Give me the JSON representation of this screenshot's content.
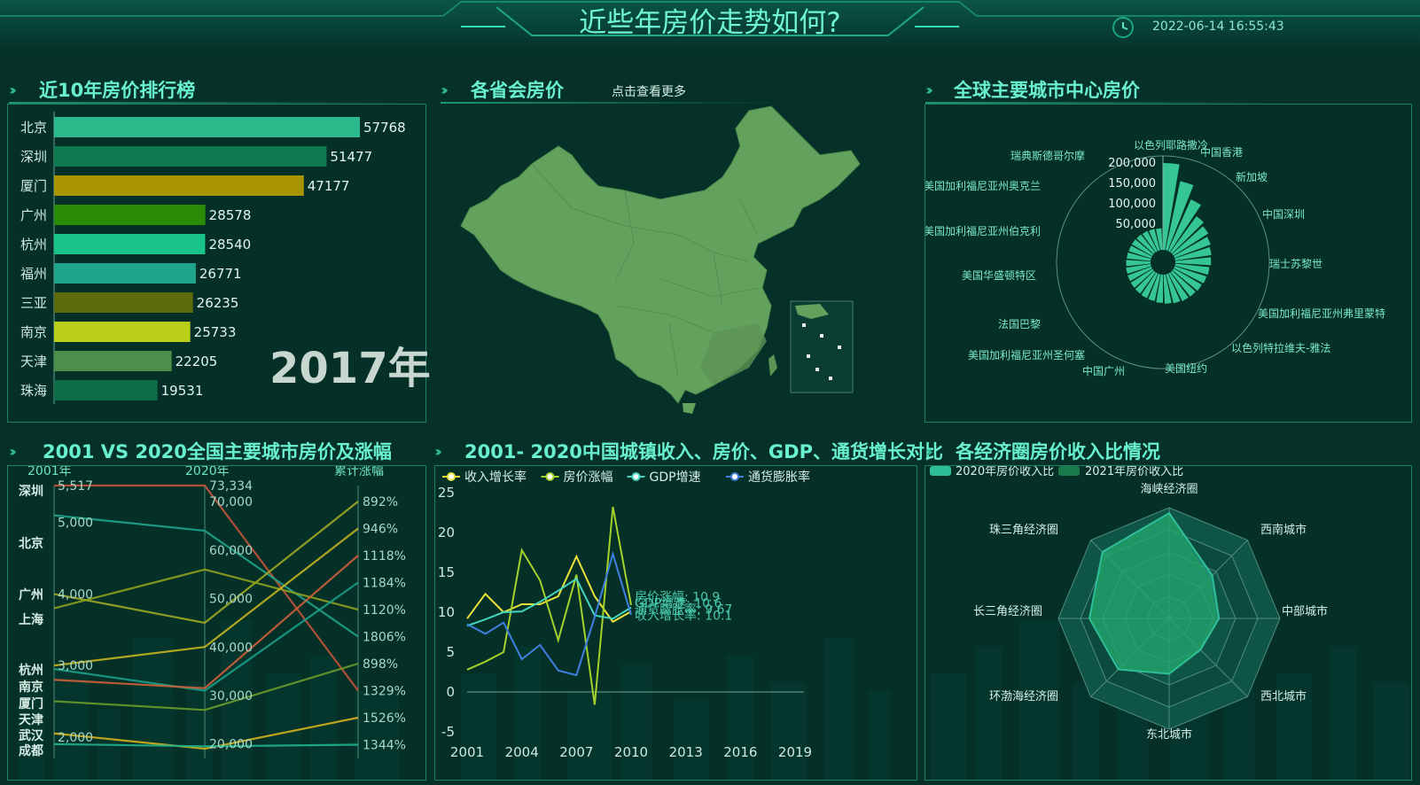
{
  "header": {
    "title": "近些年房价走势如何?",
    "datetime": "2022-06-14 16:55:43"
  },
  "ranking": {
    "title": "近10年房价排行榜",
    "year_label": "2017年",
    "cities": [
      "北京",
      "深圳",
      "厦门",
      "广州",
      "杭州",
      "福州",
      "三亚",
      "南京",
      "天津",
      "珠海"
    ],
    "values": [
      57768,
      51477,
      47177,
      28578,
      28540,
      26771,
      26235,
      25733,
      22205,
      19531
    ],
    "value_labels": [
      "57768",
      "51477",
      "47177",
      "28578",
      "28540",
      "26771",
      "26235",
      "25733",
      "22205",
      "19531"
    ],
    "colors": [
      "#2bb98c",
      "#0f7a52",
      "#a89500",
      "#2a8b06",
      "#18c488",
      "#20a58d",
      "#5d6b0c",
      "#b9cf1a",
      "#4c8f4a",
      "#0c6d47"
    ]
  },
  "map": {
    "title": "各省会房价",
    "more_label": "点击查看更多"
  },
  "global": {
    "title": "全球主要城市中心房价",
    "city_labels": [
      "中国香港",
      "新加坡",
      "中国深圳",
      "瑞士苏黎世",
      "美国加利福尼亚州弗里蒙特",
      "以色列特拉维夫-雅法",
      "美国纽约",
      "中国广州",
      "美国加利福尼亚州圣何塞",
      "法国巴黎",
      "美国华盛顿特区",
      "美国加利福尼亚州伯克利",
      "美国加利福尼亚州奥克兰",
      "瑞典斯德哥尔摩",
      "以色列耶路撒冷"
    ],
    "axis_labels": [
      "200,000",
      "150,000",
      "100,000",
      "50,000"
    ],
    "chart_data": {
      "type": "bar",
      "polar": true,
      "ylim": [
        0,
        200000
      ],
      "values": [
        185000,
        150000,
        120000,
        95000,
        88000,
        82000,
        78000,
        76000,
        73000,
        71000,
        69000,
        67000,
        66000,
        64000,
        62000,
        60000,
        58000,
        57000,
        56000,
        55000,
        54000,
        53000,
        52000,
        51000,
        50000,
        50000,
        49000,
        48000,
        47000,
        46000
      ]
    }
  },
  "parallel": {
    "title": "2001 VS 2020全国主要城市房价及涨幅",
    "axis_names": [
      "2001年",
      "2020年",
      "累计涨幅"
    ],
    "cities": [
      "深圳",
      "北京",
      "广州",
      "上海",
      "杭州",
      "南京",
      "厦门",
      "天津",
      "武汉",
      "成都"
    ],
    "ticks_2001": [
      "5,517",
      "5,000",
      "4,000",
      "3,000",
      "2,000"
    ],
    "ticks_2020": [
      "73,334",
      "70,000",
      "60,000",
      "50,000",
      "40,000",
      "30,000",
      "20,000"
    ],
    "ticks_growth": [
      "892%",
      "946%",
      "1118%",
      "1184%",
      "1120%",
      "1806%",
      "898%",
      "1329%",
      "1526%",
      "1344%"
    ],
    "chart_data": {
      "type": "line",
      "axes": [
        "2001年",
        "2020年",
        "累计涨幅"
      ],
      "series": [
        {
          "name": "深圳",
          "values": [
            5517,
            73334,
            1329
          ]
        },
        {
          "name": "北京",
          "values": [
            5100,
            64000,
            1806
          ]
        },
        {
          "name": "广州",
          "values": [
            4000,
            45000,
            892
          ]
        },
        {
          "name": "上海",
          "values": [
            3800,
            56000,
            1120
          ]
        },
        {
          "name": "杭州",
          "values": [
            3000,
            40000,
            946
          ]
        },
        {
          "name": "南京",
          "values": [
            2950,
            31000,
            1184
          ]
        },
        {
          "name": "厦门",
          "values": [
            2800,
            31500,
            1118
          ]
        },
        {
          "name": "天津",
          "values": [
            2500,
            27000,
            898
          ]
        },
        {
          "name": "武汉",
          "values": [
            2050,
            19000,
            1526
          ]
        },
        {
          "name": "成都",
          "values": [
            1900,
            19500,
            1344
          ]
        }
      ]
    }
  },
  "trend": {
    "title": "2001- 2020中国城镇收入、房价、GDP、通货增长对比",
    "end_labels": [
      "房价涨幅: 10.9",
      "GDP增速: 10.6",
      "通货膨胀率: 9.67",
      "收入增长率: 10.1"
    ],
    "chart_data": {
      "type": "line",
      "x": [
        2001,
        2002,
        2003,
        2004,
        2005,
        2006,
        2007,
        2008,
        2009,
        2010
      ],
      "xticks": [
        "2001",
        "2004",
        "2007",
        "2010",
        "2013",
        "2016",
        "2019"
      ],
      "yticks": [
        "25",
        "20",
        "15",
        "10",
        "5",
        "0",
        "-5"
      ],
      "ylim": [
        -5,
        25
      ],
      "series": [
        {
          "name": "收入增长率",
          "color": "#e8e23a",
          "values": [
            9.2,
            12.3,
            10,
            11,
            11,
            12,
            17,
            12,
            8.8,
            10.1
          ]
        },
        {
          "name": "房价涨幅",
          "color": "#a4d22c",
          "values": [
            2.8,
            3.8,
            5,
            17.8,
            14,
            6.5,
            14.7,
            -1.6,
            23.2,
            10.9
          ]
        },
        {
          "name": "GDP增速",
          "color": "#45d5c0",
          "values": [
            8.3,
            9.1,
            10,
            10.1,
            11.3,
            12.7,
            14.2,
            9.6,
            9.2,
            10.6
          ]
        },
        {
          "name": "通货膨胀率",
          "color": "#3f7fe0",
          "values": [
            8.5,
            7.3,
            8.7,
            4.1,
            5.9,
            2.7,
            2.1,
            9.4,
            17.3,
            9.67
          ]
        }
      ]
    }
  },
  "radar": {
    "title": "各经济圈房价收入比情况",
    "legend": [
      "2020年房价收入比",
      "2021年房价收入比"
    ],
    "indicators": [
      "海峡经济圈",
      "西南城市",
      "中部城市",
      "西北城市",
      "东北城市",
      "环渤海经济圈",
      "长三角经济圈",
      "珠三角经济圈"
    ],
    "chart_data": {
      "type": "radar",
      "ylim": [
        0,
        1
      ],
      "series": [
        {
          "name": "2020年房价收入比",
          "values": [
            0.95,
            0.55,
            0.45,
            0.4,
            0.5,
            0.65,
            0.72,
            0.85
          ]
        },
        {
          "name": "2021年房价收入比",
          "values": [
            0.92,
            0.5,
            0.42,
            0.38,
            0.48,
            0.62,
            0.7,
            0.82
          ]
        }
      ]
    }
  }
}
